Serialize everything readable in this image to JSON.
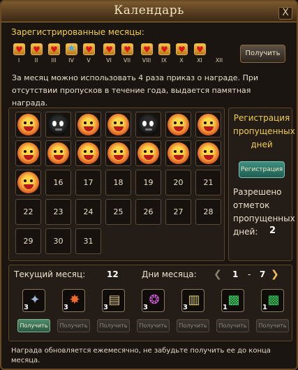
{
  "window": {
    "title": "Календарь",
    "close_glyph": "X"
  },
  "registered": {
    "header": "Зарегистрированные месяцы:",
    "months": [
      {
        "label": "I",
        "icon": "heart-icon",
        "state": "done"
      },
      {
        "label": "II",
        "icon": "heart-icon",
        "state": "done"
      },
      {
        "label": "III",
        "icon": "heart-icon",
        "state": "done"
      },
      {
        "label": "IV",
        "icon": "star-icon",
        "state": "current"
      },
      {
        "label": "V",
        "icon": "heart-icon",
        "state": "done"
      },
      {
        "label": "VI",
        "icon": "heart-icon",
        "state": "done"
      },
      {
        "label": "VII",
        "icon": "heart-icon",
        "state": "done"
      },
      {
        "label": "VIII",
        "icon": "heart-icon",
        "state": "done"
      },
      {
        "label": "IX",
        "icon": "heart-icon",
        "state": "done"
      },
      {
        "label": "X",
        "icon": "heart-icon",
        "state": "done"
      },
      {
        "label": "XI",
        "icon": "heart-icon",
        "state": "done"
      },
      {
        "label": "XII",
        "icon": "",
        "state": "empty"
      }
    ],
    "claim_label": "Получить"
  },
  "info_text": "За месяц можно использовать 4 раза приказ о награде. При отсутствии пропусков в течение года, выдается памятная награда.",
  "calendar": {
    "days": [
      {
        "label": "",
        "mark": "checked"
      },
      {
        "label": "",
        "mark": "missed"
      },
      {
        "label": "",
        "mark": "checked"
      },
      {
        "label": "",
        "mark": "checked"
      },
      {
        "label": "",
        "mark": "missed"
      },
      {
        "label": "",
        "mark": "checked"
      },
      {
        "label": "",
        "mark": "checked"
      },
      {
        "label": "",
        "mark": "checked"
      },
      {
        "label": "",
        "mark": "checked"
      },
      {
        "label": "",
        "mark": "checked"
      },
      {
        "label": "",
        "mark": "checked"
      },
      {
        "label": "",
        "mark": "checked"
      },
      {
        "label": "",
        "mark": "checked"
      },
      {
        "label": "",
        "mark": "checked"
      },
      {
        "label": "",
        "mark": "checked"
      },
      {
        "label": "16",
        "mark": "none"
      },
      {
        "label": "17",
        "mark": "none"
      },
      {
        "label": "18",
        "mark": "none"
      },
      {
        "label": "19",
        "mark": "none"
      },
      {
        "label": "20",
        "mark": "none"
      },
      {
        "label": "21",
        "mark": "none"
      },
      {
        "label": "22",
        "mark": "none"
      },
      {
        "label": "23",
        "mark": "none"
      },
      {
        "label": "24",
        "mark": "none"
      },
      {
        "label": "25",
        "mark": "none"
      },
      {
        "label": "26",
        "mark": "none"
      },
      {
        "label": "27",
        "mark": "none"
      },
      {
        "label": "28",
        "mark": "none"
      },
      {
        "label": "29",
        "mark": "none"
      },
      {
        "label": "30",
        "mark": "none"
      },
      {
        "label": "31",
        "mark": "none"
      }
    ]
  },
  "side": {
    "title": "Регистрация пропущенных дней",
    "register_label": "Регистрация",
    "allowed_text": "Разрешено отметок пропущенных дней:",
    "allowed_count": "2"
  },
  "rewards": {
    "current_month_label": "Текущий месяц:",
    "current_month_value": "12",
    "month_days_label": "Дни месяца:",
    "days_from": "1",
    "days_dash": "-",
    "days_to": "7",
    "items": [
      {
        "icon": "horn-icon",
        "count": "3",
        "glyph": "✦",
        "color": "#9fb4d8",
        "button": "Получить",
        "enabled": true
      },
      {
        "icon": "fire-burst-icon",
        "count": "3",
        "glyph": "✸",
        "color": "#f06a2a",
        "button": "Получить",
        "enabled": false
      },
      {
        "icon": "scroll-icon",
        "count": "3",
        "glyph": "▤",
        "color": "#d8c27a",
        "button": "Получить",
        "enabled": false
      },
      {
        "icon": "magic-seal-icon",
        "count": "3",
        "glyph": "❂",
        "color": "#d05ad8",
        "button": "Получить",
        "enabled": false
      },
      {
        "icon": "map-scroll-icon",
        "count": "3",
        "glyph": "▥",
        "color": "#d8d06a",
        "button": "Получить",
        "enabled": false
      },
      {
        "icon": "green-rune-icon",
        "count": "1",
        "glyph": "▩",
        "color": "#3ad86a",
        "button": "Получить",
        "enabled": false
      },
      {
        "icon": "green-rune-icon",
        "count": "1",
        "glyph": "▩",
        "color": "#2ad05a",
        "button": "Получить",
        "enabled": false
      }
    ],
    "footer": "Награда обновляется ежемесячно, не забудьте получить ее до конца месяца."
  }
}
